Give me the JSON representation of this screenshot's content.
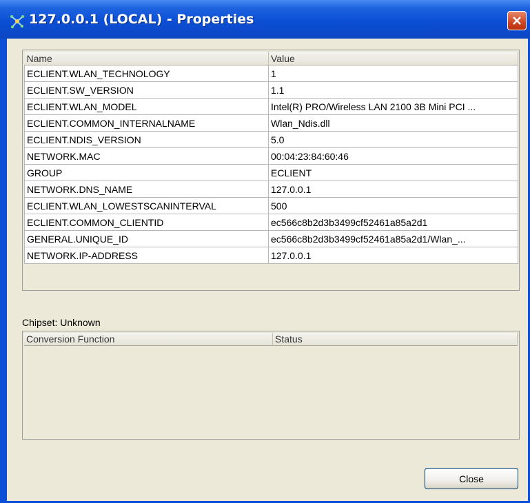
{
  "window": {
    "title": "127.0.0.1 (LOCAL) - Properties",
    "title_icon": "network-node-icon",
    "close_icon": "close-icon"
  },
  "properties": {
    "columns": [
      "Name",
      "Value"
    ],
    "rows": [
      {
        "name": "ECLIENT.WLAN_TECHNOLOGY",
        "value": "1"
      },
      {
        "name": "ECLIENT.SW_VERSION",
        "value": "1.1"
      },
      {
        "name": "ECLIENT.WLAN_MODEL",
        "value": "Intel(R) PRO/Wireless LAN 2100 3B Mini PCI ..."
      },
      {
        "name": "ECLIENT.COMMON_INTERNALNAME",
        "value": "Wlan_Ndis.dll"
      },
      {
        "name": "ECLIENT.NDIS_VERSION",
        "value": "5.0"
      },
      {
        "name": "NETWORK.MAC",
        "value": "00:04:23:84:60:46"
      },
      {
        "name": "GROUP",
        "value": "ECLIENT"
      },
      {
        "name": "NETWORK.DNS_NAME",
        "value": "127.0.0.1"
      },
      {
        "name": "ECLIENT.WLAN_LOWESTSCANINTERVAL",
        "value": "500"
      },
      {
        "name": "ECLIENT.COMMON_CLIENTID",
        "value": "ec566c8b2d3b3499cf52461a85a2d1"
      },
      {
        "name": "GENERAL.UNIQUE_ID",
        "value": "ec566c8b2d3b3499cf52461a85a2d1/Wlan_..."
      },
      {
        "name": "NETWORK.IP-ADDRESS",
        "value": "127.0.0.1"
      }
    ]
  },
  "chipset": {
    "label": "Chipset: Unknown"
  },
  "conversion": {
    "columns": [
      "Conversion Function",
      "Status"
    ]
  },
  "buttons": {
    "close_label": "Close"
  },
  "colors": {
    "titlebar": "#0b4fd5",
    "client": "#ece9d8",
    "close_button_red": "#cf4623"
  }
}
